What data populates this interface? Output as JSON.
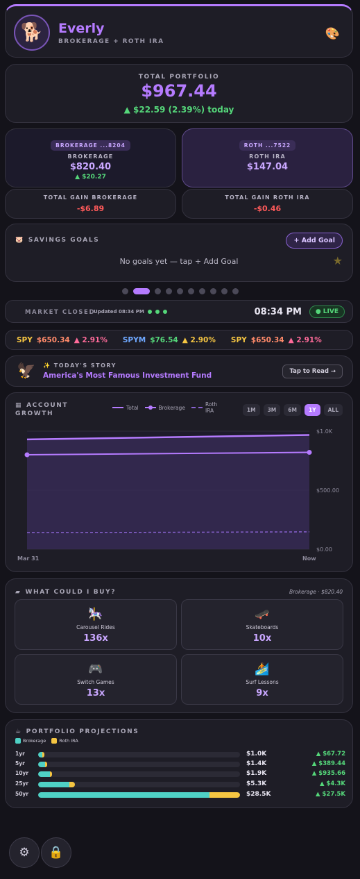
{
  "header": {
    "avatar": "🐕",
    "name": "Everly",
    "subtitle": "BROKERAGE + ROTH IRA",
    "theme_icon": "🎨"
  },
  "total": {
    "label": "TOTAL PORTFOLIO",
    "value": "$967.44",
    "change": "▲ $22.59 (2.39%) today"
  },
  "accounts": [
    {
      "pill": "BROKERAGE ...8204",
      "name": "BROKERAGE",
      "value": "$820.40",
      "change": "▲ $20.27"
    },
    {
      "pill": "ROTH ...7522",
      "name": "ROTH IRA",
      "value": "$147.04",
      "change": ""
    }
  ],
  "gains": [
    {
      "label": "TOTAL GAIN BROKERAGE",
      "value": "-$6.89"
    },
    {
      "label": "TOTAL GAIN ROTH IRA",
      "value": "-$0.46"
    }
  ],
  "savings": {
    "icon": "🐷",
    "title": "SAVINGS GOALS",
    "add_label": "+ Add Goal",
    "empty": "No goals yet — tap + Add Goal",
    "deco": "★"
  },
  "pager": {
    "count": 10,
    "active": 1
  },
  "market": {
    "status": "MARKET CLOSED",
    "updated": "Updated 08:34 PM",
    "time": "08:34 PM",
    "live": "● LIVE"
  },
  "ticker": [
    {
      "sym": "SPY",
      "price": "$650.34",
      "chg": "▲ 2.91%"
    },
    {
      "sym": "SPYM",
      "price": "$76.54",
      "chg": "▲ 2.90%"
    },
    {
      "sym": "SPY",
      "price": "$650.34",
      "chg": "▲ 2.91%"
    }
  ],
  "story": {
    "icon": "🦅",
    "label": "✨ TODAY'S STORY",
    "title": "America's Most Famous Investment Fund",
    "button": "Tap to Read →"
  },
  "growth": {
    "title_line1": "ACCOUNT",
    "title_line2": "GROWTH",
    "legend": [
      "Total",
      "Brokerage",
      "Roth IRA"
    ],
    "ranges": [
      "1M",
      "3M",
      "6M",
      "1Y",
      "ALL"
    ],
    "active_range": "1Y",
    "colors": {
      "total": "#b57bff",
      "brokerage": "#b57bff",
      "roth": "#8a63d2"
    }
  },
  "chart_data": {
    "type": "line",
    "x": [
      "Mar 31",
      "Now"
    ],
    "series": [
      {
        "name": "Total",
        "values": [
          930,
          967.44
        ]
      },
      {
        "name": "Brokerage",
        "values": [
          800,
          820.4
        ]
      },
      {
        "name": "Roth IRA",
        "values": [
          140,
          147.04
        ]
      }
    ],
    "y_ticks": [
      "$1.0K",
      "$500.00",
      "$0.00"
    ],
    "ylim": [
      0,
      1000
    ],
    "x_labels": [
      "Mar 31",
      "Now"
    ]
  },
  "buy": {
    "title": "WHAT COULD I BUY?",
    "source": "Brokerage · $820.40",
    "items": [
      {
        "icon": "🎠",
        "name": "Carousel Rides",
        "count": "136x"
      },
      {
        "icon": "🛹",
        "name": "Skateboards",
        "count": "10x"
      },
      {
        "icon": "🎮",
        "name": "Switch Games",
        "count": "13x"
      },
      {
        "icon": "🏄",
        "name": "Surf Lessons",
        "count": "9x"
      }
    ]
  },
  "projections": {
    "title": "PORTFOLIO PROJECTIONS",
    "legend": [
      "Brokerage",
      "Roth IRA"
    ],
    "colors": {
      "brokerage": "#4fd1c5",
      "roth": "#f5c542"
    },
    "rows": [
      {
        "label": "1yr",
        "brokerage": 0.017,
        "roth": 0.003,
        "value": "$1.0K",
        "gain": "▲ $67.72"
      },
      {
        "label": "5yr",
        "brokerage": 0.033,
        "roth": 0.006,
        "value": "$1.4K",
        "gain": "▲ $389.44"
      },
      {
        "label": "10yr",
        "brokerage": 0.057,
        "roth": 0.01,
        "value": "$1.9K",
        "gain": "▲ $935.66"
      },
      {
        "label": "25yr",
        "brokerage": 0.155,
        "roth": 0.028,
        "value": "$5.3K",
        "gain": "▲ $4.3K"
      },
      {
        "label": "50yr",
        "brokerage": 0.848,
        "roth": 0.152,
        "value": "$28.5K",
        "gain": "▲ $27.5K"
      }
    ]
  },
  "bottom": {
    "settings_icon": "⚙",
    "lock_icon": "🔒"
  }
}
